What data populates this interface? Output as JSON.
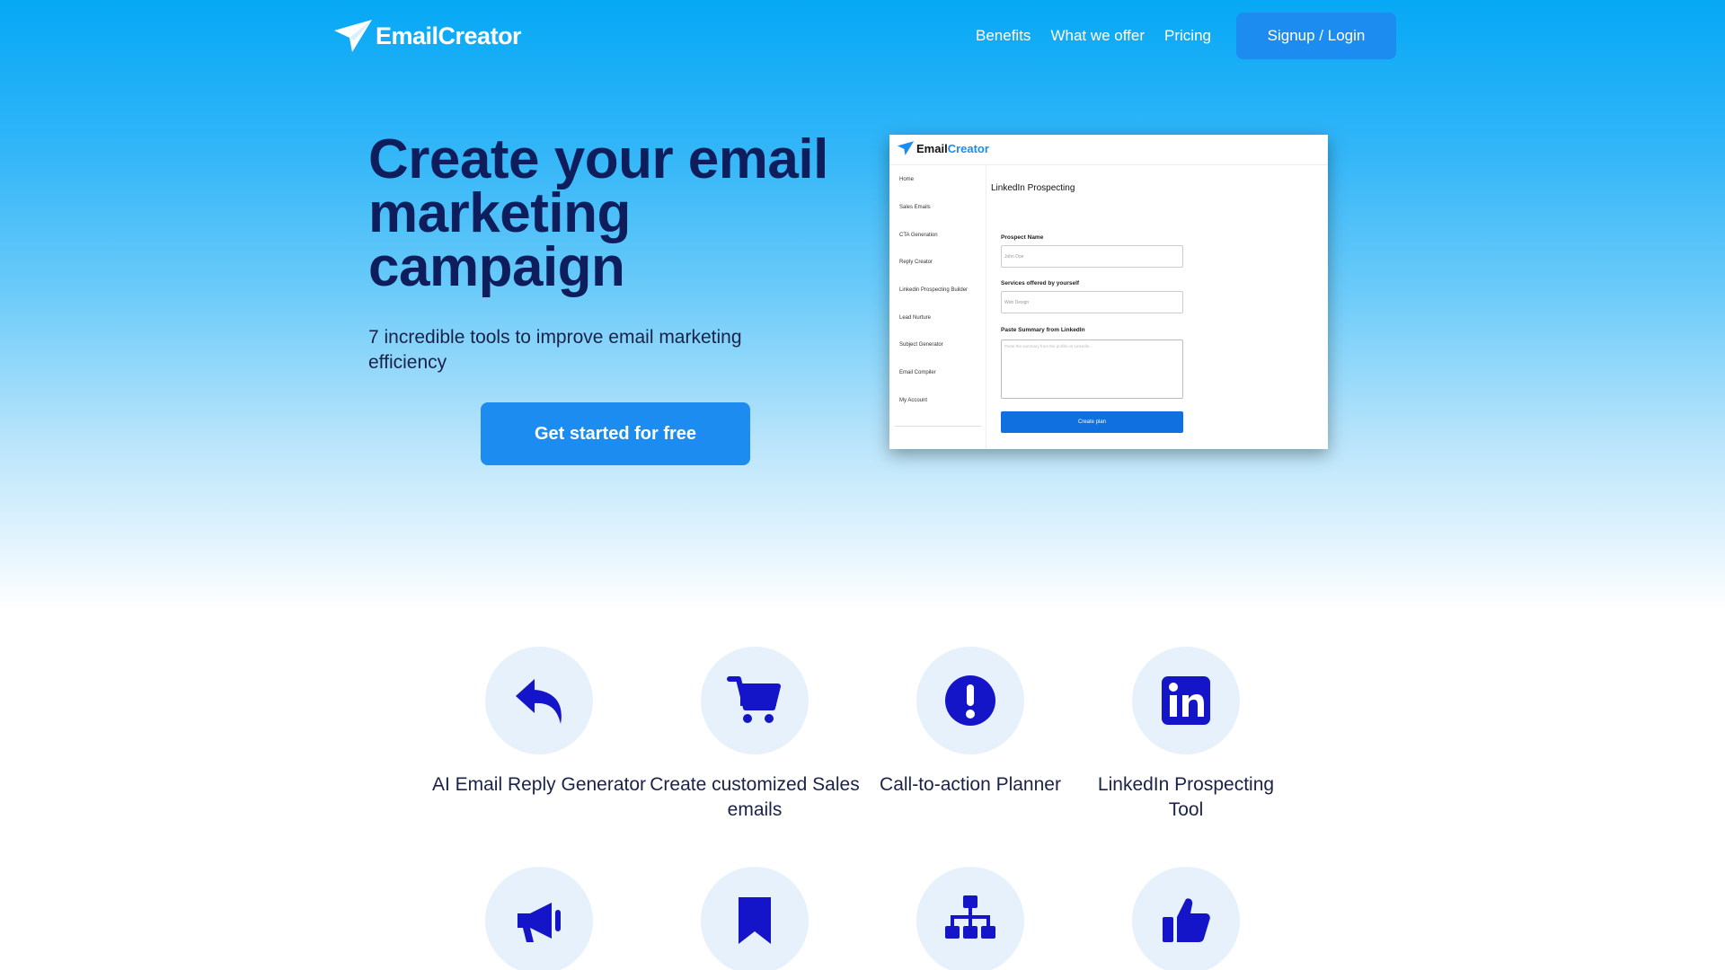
{
  "nav": {
    "logo": "EmailCreator",
    "links": [
      "Benefits",
      "What we offer",
      "Pricing"
    ],
    "cta": "Signup / Login"
  },
  "hero": {
    "title": "Create your email marketing campaign",
    "subtitle": "7 incredible tools to improve email marketing efficiency",
    "cta": "Get started for free"
  },
  "preview": {
    "logo_a": "Email",
    "logo_b": "Creator",
    "sidebar": [
      "Home",
      "Sales Emails",
      "CTA Generation",
      "Reply Creator",
      "Linkedin Prospecting Builder",
      "Lead Nurture",
      "Subject Generator",
      "Email Compiler",
      "My Account"
    ],
    "page_title": "LinkedIn Prospecting",
    "field1_label": "Prospect Name",
    "field1_value": "John Doe",
    "field2_label": "Services offered by yourself",
    "field2_value": "Web Design",
    "field3_label": "Paste Summary from LinkedIn",
    "field3_placeholder": "Paste the summary from the profile on Linkedin...",
    "button": "Create plan"
  },
  "features": [
    {
      "label": "AI Email Reply Generator",
      "icon": "reply-icon"
    },
    {
      "label": "Create customized Sales emails",
      "icon": "cart-icon"
    },
    {
      "label": "Call-to-action Planner",
      "icon": "exclamation-icon"
    },
    {
      "label": "LinkedIn Prospecting Tool",
      "icon": "linkedin-icon"
    },
    {
      "label": "",
      "icon": "megaphone-icon"
    },
    {
      "label": "",
      "icon": "bookmark-icon"
    },
    {
      "label": "",
      "icon": "sitemap-icon"
    },
    {
      "label": "",
      "icon": "thumbs-up-icon"
    }
  ],
  "colors": {
    "brand_blue": "#1c8cf0",
    "title_navy": "#0e1e5c",
    "icon_blue": "#1414c8",
    "icon_circle": "#e7f1fc"
  }
}
